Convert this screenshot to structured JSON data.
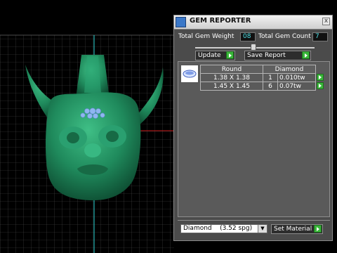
{
  "panel": {
    "title": "GEM REPORTER",
    "close_glyph": "x",
    "total_weight_label": "Total Gem Weight",
    "total_weight_value": "08",
    "total_count_label": "Total Gem Count",
    "total_count_value": "7",
    "update_label": "Update",
    "save_report_label": "Save Report"
  },
  "table": {
    "headers": [
      "Round",
      "Diamond"
    ],
    "rows": [
      {
        "size": "1.38 X 1.38",
        "count": "1",
        "weight": "0.010tw"
      },
      {
        "size": "1.45 X 1.45",
        "count": "6",
        "weight": "0.07tw"
      }
    ]
  },
  "material": {
    "selected": "Diamond    (3.52 spg)",
    "set_label": "Set Material"
  },
  "colors": {
    "model_green": "#1f8a5c",
    "gem_blue": "#8fb6f0",
    "play_green": "#39b639",
    "value_cyan": "#4fe0e6"
  },
  "icons": [
    "gem-reporter-icon",
    "close-icon",
    "update-go-icon",
    "save-report-go-icon",
    "gem-thumbnail-icon",
    "row-go-icon",
    "dropdown-arrow-icon",
    "set-material-go-icon"
  ]
}
